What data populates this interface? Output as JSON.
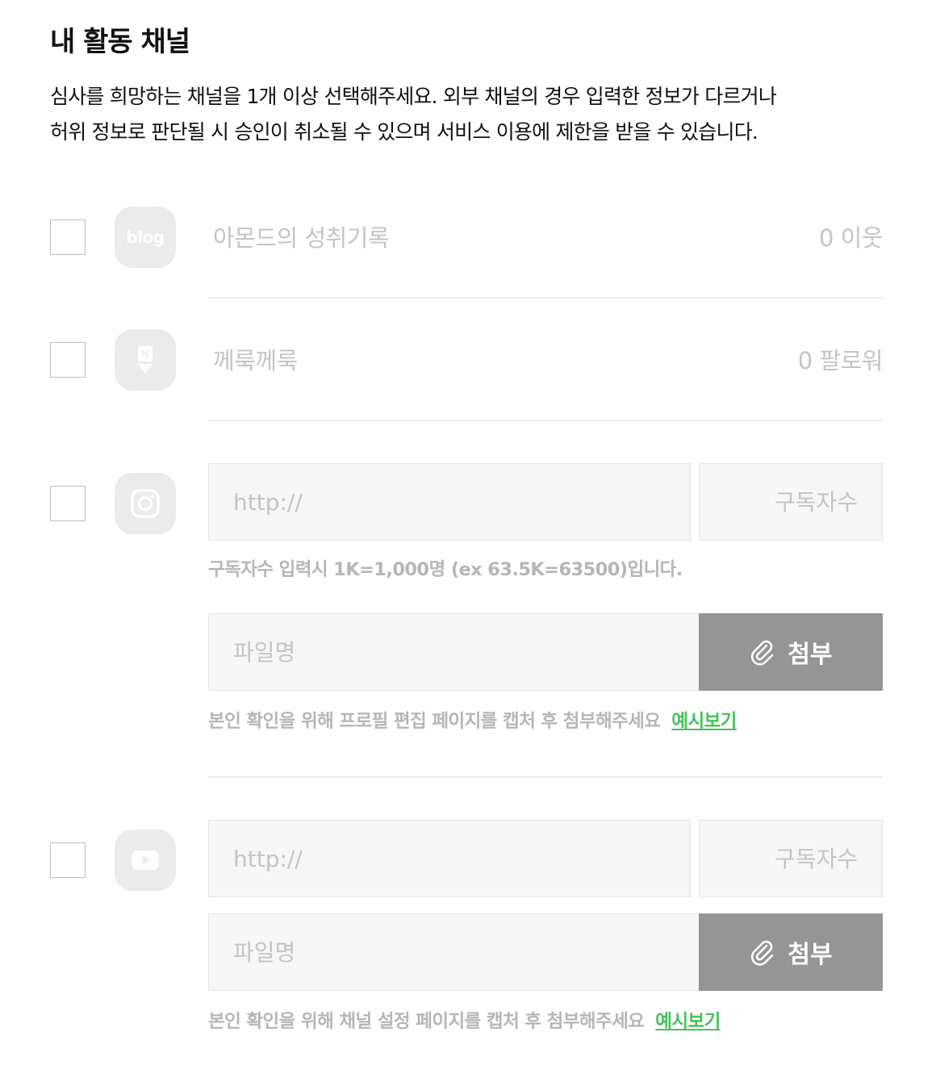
{
  "page": {
    "title": "내 활동 채널",
    "description_line1": "심사를 희망하는 채널을 1개 이상 선택해주세요. 외부 채널의 경우 입력한 정보가 다르거나",
    "description_line2": "허위 정보로 판단될 시 승인이 취소될 수 있으며 서비스 이용에 제한을 받을 수 있습니다."
  },
  "channels": {
    "blog": {
      "icon": "blog-icon",
      "icon_text": "blog",
      "name": "아몬드의 성취기록",
      "count": "0 이웃"
    },
    "post": {
      "icon": "naver-post-icon",
      "name": "께룩께룩",
      "count": "0 팔로워"
    },
    "instagram": {
      "icon": "instagram-icon",
      "url_placeholder": "http://",
      "subs_placeholder": "구독자수",
      "subs_hint": "구독자수 입력시 1K=1,000명 (ex 63.5K=63500)입니다.",
      "file_placeholder": "파일명",
      "attach_label": "첨부",
      "attach_hint": "본인 확인을 위해 프로필 편집 페이지를 캡처 후 첨부해주세요",
      "example_link": "예시보기"
    },
    "youtube": {
      "icon": "youtube-icon",
      "url_placeholder": "http://",
      "subs_placeholder": "구독자수",
      "file_placeholder": "파일명",
      "attach_label": "첨부",
      "attach_hint": "본인 확인을 위해 채널 설정 페이지를 캡처 후 첨부해주세요",
      "example_link": "예시보기"
    }
  },
  "colors": {
    "accent_link": "#44c35a",
    "attach_button": "#959595",
    "icon_bg": "#ebebeb"
  }
}
